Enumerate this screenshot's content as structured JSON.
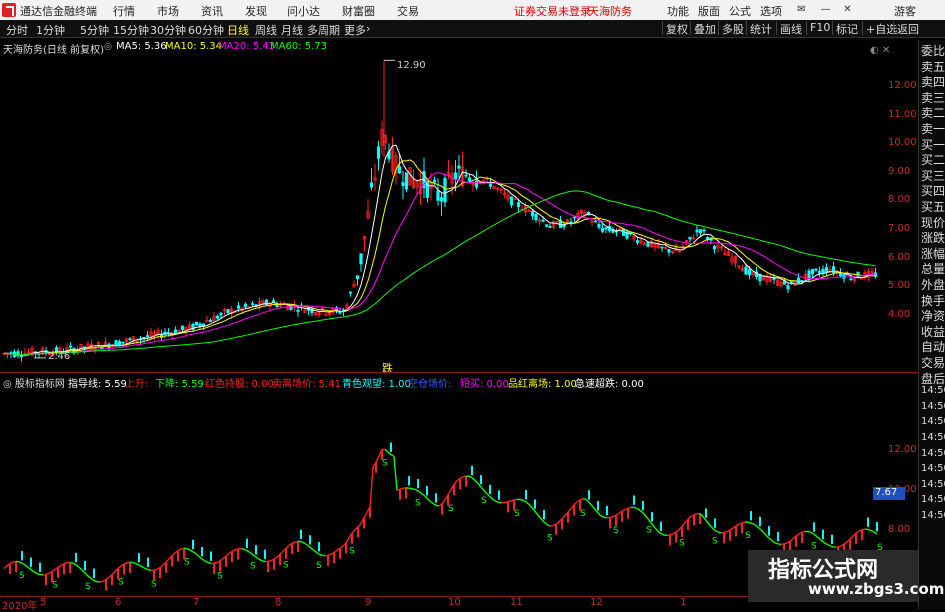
{
  "menubar": {
    "app_title": "通达信金融终端",
    "menus": [
      "行情",
      "市场",
      "资讯",
      "发现",
      "问小达",
      "财富圈",
      "交易"
    ],
    "warning": "证券交易未登录",
    "broker": "天海防务",
    "right_items": [
      "功能",
      "版面",
      "公式",
      "选项"
    ],
    "guest": "游客"
  },
  "periodbar": {
    "periods": [
      "分时",
      "1分钟",
      "5分钟",
      "15分钟",
      "30分钟",
      "60分钟",
      "日线",
      "周线",
      "月线",
      "多周期",
      "更多"
    ],
    "active": "日线",
    "right_buttons": [
      "复权",
      "叠加",
      "多股",
      "统计",
      "画线",
      "F10",
      "标记",
      "+自选",
      "返回"
    ]
  },
  "main_panel": {
    "title": "天海防务(日线 前复权)",
    "ma": [
      {
        "label": "MA5: 5.36",
        "color": "#ffffff"
      },
      {
        "label": "MA10: 5.34",
        "color": "#ffff00"
      },
      {
        "label": "MA20: 5.43",
        "color": "#ff00ff"
      },
      {
        "label": "MA60: 5.73",
        "color": "#00ff00"
      }
    ],
    "high_label": "12.90",
    "low_label": "2.46",
    "y_ticks": [
      "12.00",
      "11.00",
      "10.00",
      "9.00",
      "8.00",
      "7.00",
      "6.00",
      "5.00",
      "4.00"
    ]
  },
  "signal_text": "跌",
  "indicator_panel": {
    "title": "股标指标网",
    "items": [
      {
        "label": "指导线: 5.59",
        "color": "#ffffff"
      },
      {
        "label": "上升: ",
        "color": "#ff2020"
      },
      {
        "label": "下降: 5.59",
        "color": "#00ff00"
      },
      {
        "label": "红色持股: 0.00",
        "color": "#ff2020"
      },
      {
        "label": "卖离场价: 5.41",
        "color": "#ff2020"
      },
      {
        "label": "青色观望: 1.00",
        "color": "#00ffff"
      },
      {
        "label": "空仓场价:",
        "color": "#3060ff"
      },
      {
        "label": "短买: 0.00",
        "color": "#ff00ff"
      },
      {
        "label": "品红离场: 1.00",
        "color": "#ffff00"
      },
      {
        "label": "急速超跌: 0.00",
        "color": "#ffffff"
      }
    ],
    "y_ticks": [
      "12.00",
      "10.00",
      "8.00",
      "6.00"
    ],
    "current_value": "7.67"
  },
  "side_column": [
    "委比",
    "卖五",
    "卖四",
    "卖三",
    "卖二",
    "卖一",
    "买一",
    "买二",
    "买三",
    "买四",
    "买五",
    "现价",
    "涨跌",
    "涨幅",
    "总量",
    "外盘",
    "换手",
    "净资",
    "收益",
    "自动",
    "交易",
    "盘后",
    "14:50",
    "14:50",
    "14:50",
    "14:50",
    "14:50",
    "14:50",
    "14:50",
    "14:50",
    "14:50"
  ],
  "x_axis": [
    "2020年",
    "5",
    "6",
    "7",
    "8",
    "9",
    "10",
    "11",
    "12",
    "1"
  ],
  "watermark": {
    "line1": "指标公式网",
    "line2": "www.zbgs3.com"
  },
  "colors": {
    "up": "#ff2020",
    "down": "#00ffff",
    "ma5": "#ffffff",
    "ma10": "#ffff00",
    "ma20": "#ff00ff",
    "ma60": "#00ff00"
  }
}
